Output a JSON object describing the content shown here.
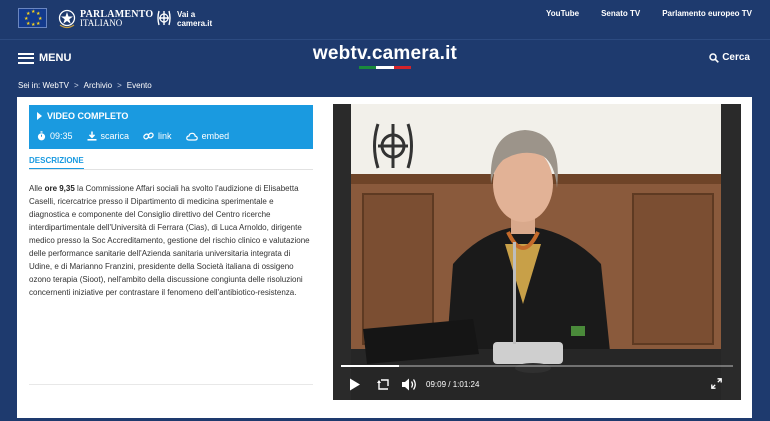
{
  "topbar": {
    "parlamento_line1": "PARLAMENTO",
    "parlamento_line2": "ITALIANO",
    "vai_line1": "Vai a",
    "vai_line2": "camera.it",
    "links": [
      "YouTube",
      "Senato TV",
      "Parlamento europeo TV"
    ]
  },
  "header": {
    "menu_label": "MENU",
    "brand": "webtv.camera.it",
    "search_label": "Cerca",
    "tricolor": [
      "#1a8a3c",
      "#ffffff",
      "#d2232a"
    ]
  },
  "breadcrumb": {
    "items": [
      "Sei in: WebTV",
      "Archivio",
      "Evento"
    ],
    "separator": ">"
  },
  "video_box": {
    "title": "VIDEO COMPLETO",
    "duration": "09:35",
    "download": "scarica",
    "link": "link",
    "embed": "embed"
  },
  "description": {
    "tab": "DESCRIZIONE",
    "prefix": "Alle ",
    "time_bold": "ore 9,35",
    "body": " la Commissione Affari sociali ha svolto l'audizione di Elisabetta Caselli, ricercatrice presso il Dipartimento di medicina sperimentale e diagnostica e componente del Consiglio direttivo del Centro ricerche interdipartimentale dell'Università di Ferrara (Cias), di Luca Arnoldo, dirigente medico presso la Soc Accreditamento, gestione del rischio clinico e valutazione delle performance sanitarie dell'Azienda sanitaria universitaria integrata di Udine, e di Marianno Franzini, presidente della Società italiana di ossigeno ozono terapia (Sioot), nell'ambito della discussione congiunta delle risoluzioni concernenti iniziative per contrastare il fenomeno dell'antibiotico-resistenza."
  },
  "player": {
    "current_time": "09:09",
    "time_separator": "/",
    "total_time": "1:01:24",
    "progress": 0.149
  },
  "colors": {
    "page_bg": "#1e3a6e",
    "accent": "#1a9ae0"
  }
}
